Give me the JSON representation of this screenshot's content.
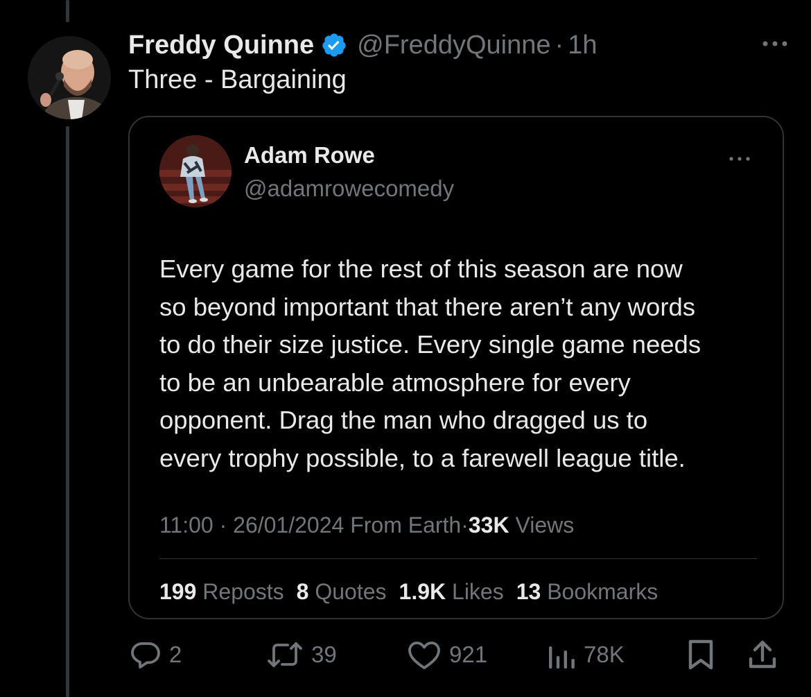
{
  "tweet": {
    "author_name": "Freddy Quinne",
    "author_handle": "@FreddyQuinne",
    "separator": "·",
    "time": "1h",
    "text": "Three - Bargaining",
    "verified": true
  },
  "quote": {
    "author_name": "Adam Rowe",
    "author_handle": "@adamrowecomedy",
    "text": "Every game for the rest of this season are now\nso beyond important that there aren’t any words\nto do their size justice. Every single game needs\nto be an unbearable atmosphere for every\nopponent. Drag the man who dragged us to\nevery trophy possible, to a farewell league title.",
    "meta": {
      "time": "11:00",
      "date": "26/01/2024",
      "source": "From Earth",
      "separator": "·",
      "views_count": "33K",
      "views_label": "Views"
    },
    "stats": {
      "reposts_count": "199",
      "reposts_label": "Reposts",
      "quotes_count": "8",
      "quotes_label": "Quotes",
      "likes_count": "1.9K",
      "likes_label": "Likes",
      "bookmarks_count": "13",
      "bookmarks_label": "Bookmarks"
    }
  },
  "actions": {
    "replies": "2",
    "reposts": "39",
    "likes": "921",
    "views": "78K"
  },
  "icons": {
    "verified": "verified-badge-icon",
    "more": "more-options-icon",
    "reply": "reply-icon",
    "repost": "repost-icon",
    "like": "heart-icon",
    "views": "views-chart-icon",
    "bookmark": "bookmark-icon",
    "share": "share-icon"
  },
  "colors": {
    "background": "#000000",
    "text_primary": "#e7e9ea",
    "text_secondary": "#71767b",
    "border": "#2f3336",
    "verified_blue": "#1d9bf0"
  }
}
